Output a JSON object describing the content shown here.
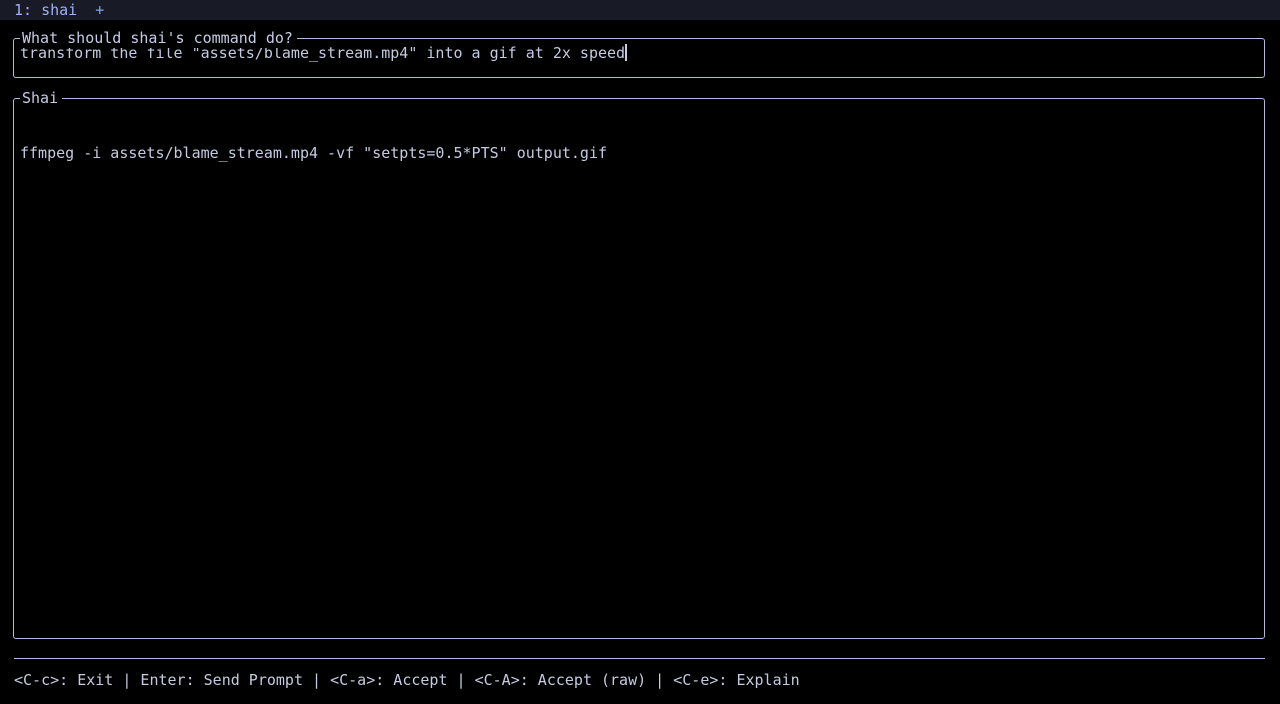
{
  "tabbar": {
    "tabs": [
      {
        "label": "1: shai"
      }
    ],
    "add_label": "+"
  },
  "prompt_panel": {
    "title": "What should shai's command do?",
    "value": "transform the file \"assets/blame_stream.mp4\" into a gif at 2x speed",
    "placeholder": "What should shai's command do?"
  },
  "output_panel": {
    "title": "Shai",
    "command": "ffmpeg -i assets/blame_stream.mp4 -vf \"setpts=0.5*PTS\" output.gif"
  },
  "footer": {
    "text": "<C-c>: Exit | Enter: Send Prompt | <C-a>: Accept | <C-A>: Accept (raw) | <C-e>: Explain",
    "shortcuts": [
      {
        "key": "<C-c>",
        "action": "Exit"
      },
      {
        "key": "Enter",
        "action": "Send Prompt"
      },
      {
        "key": "<C-a>",
        "action": "Accept"
      },
      {
        "key": "<C-A>",
        "action": "Accept (raw)"
      },
      {
        "key": "<C-e>",
        "action": "Explain"
      }
    ]
  },
  "colors": {
    "background": "#000000",
    "tabbar_background": "#181a26",
    "border": "#b2badf",
    "text": "#c5cae0",
    "tab_active": "#9fb0f5",
    "accent": "#7aa2f7"
  }
}
